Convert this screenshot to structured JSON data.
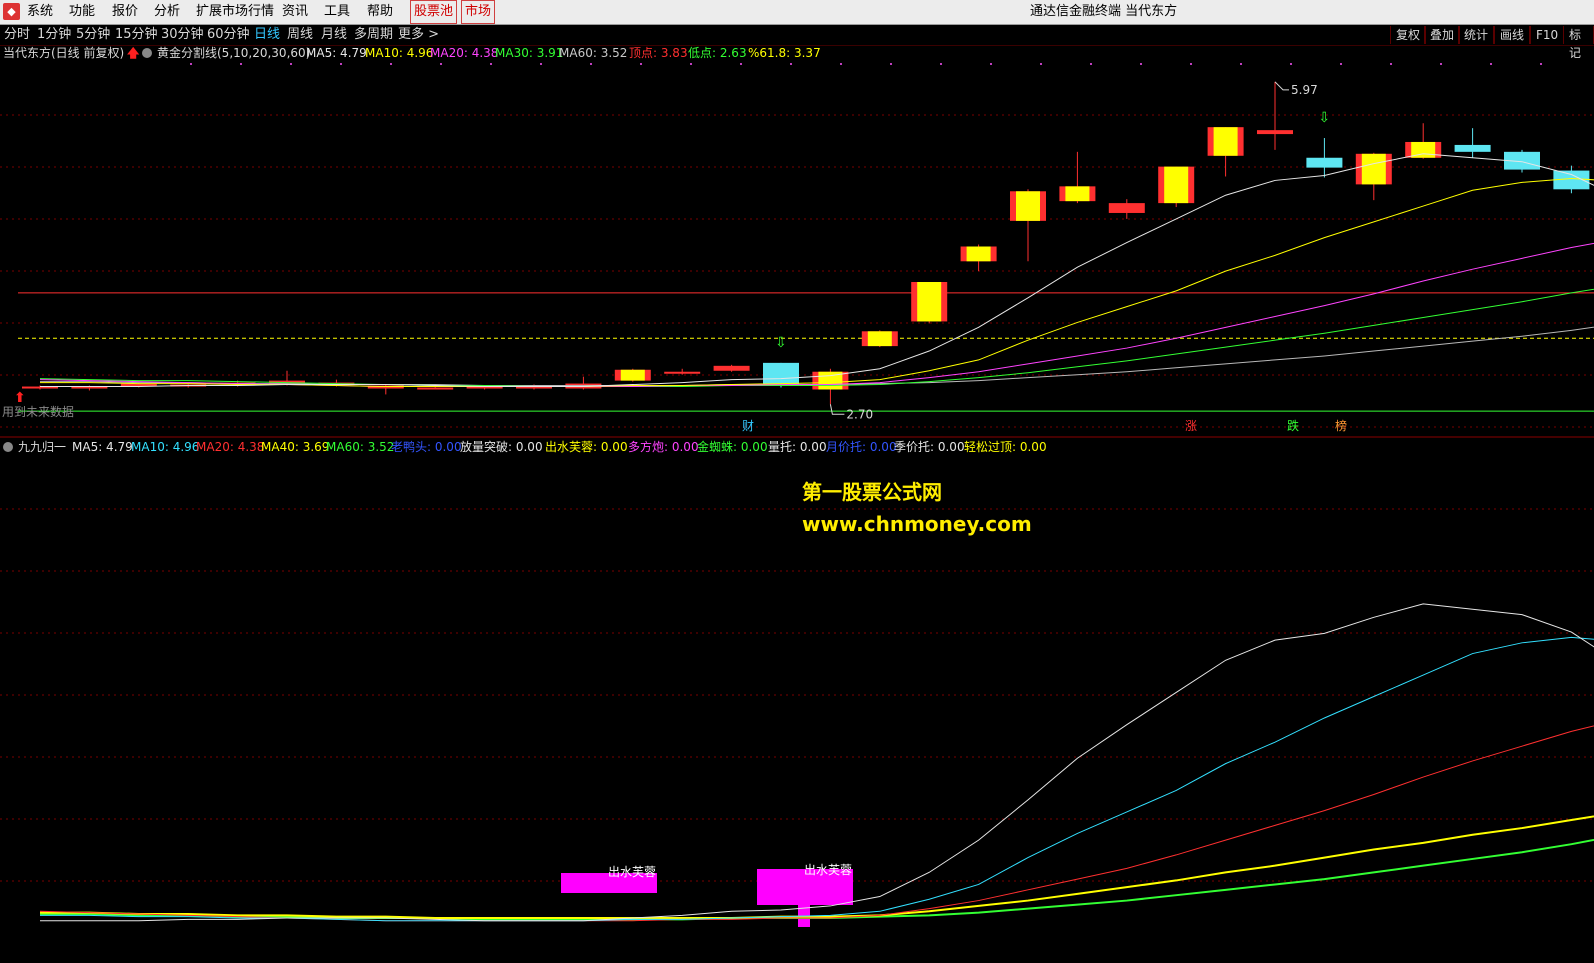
{
  "menubar": {
    "items": [
      "系统",
      "功能",
      "报价",
      "分析",
      "扩展市场行情",
      "资讯",
      "工具",
      "帮助"
    ],
    "stock_pool": "股票池",
    "market": "市场",
    "title": "通达信金融终端  当代东方"
  },
  "period_tabs": [
    "分时",
    "1分钟",
    "5分钟",
    "15分钟",
    "30分钟",
    "60分钟",
    "日线",
    "周线",
    "月线",
    "多周期",
    "更多 >"
  ],
  "active_period": "日线",
  "toolbar": [
    "复权",
    "叠加",
    "统计",
    "画线",
    "F10",
    "标记"
  ],
  "main_legend": {
    "stock": "当代东方(日线 前复权)",
    "indicator": "黄金分割线(5,10,20,30,60)",
    "items": [
      {
        "label": "MA5: 4.79",
        "color": "#e6e6e6"
      },
      {
        "label": "MA10: 4.96",
        "color": "#ffff00"
      },
      {
        "label": "MA20: 4.38",
        "color": "#ff44ff"
      },
      {
        "label": "MA30: 3.91",
        "color": "#33ff33"
      },
      {
        "label": "MA60: 3.52",
        "color": "#c8c8c8"
      },
      {
        "label": "顶点: 3.83",
        "color": "#ff3030"
      },
      {
        "label": "低点: 2.63",
        "color": "#33ff33"
      },
      {
        "label": "%61.8: 3.37",
        "color": "#ffff00"
      }
    ]
  },
  "main_chart": {
    "high_label": "5.97",
    "low_label": "2.70",
    "future_note": "用到未来数据",
    "event_markers": [
      "财",
      "涨",
      "跌",
      "榜"
    ],
    "candles": [
      {
        "o": 2.87,
        "c": 2.88,
        "h": 2.89,
        "l": 2.85
      },
      {
        "o": 2.88,
        "c": 2.87,
        "h": 2.89,
        "l": 2.84
      },
      {
        "o": 2.88,
        "c": 2.91,
        "h": 2.92,
        "l": 2.87
      },
      {
        "o": 2.9,
        "c": 2.89,
        "h": 2.91,
        "l": 2.87
      },
      {
        "o": 2.92,
        "c": 2.9,
        "h": 2.94,
        "l": 2.88
      },
      {
        "o": 2.9,
        "c": 2.94,
        "h": 3.04,
        "l": 2.89
      },
      {
        "o": 2.92,
        "c": 2.9,
        "h": 2.95,
        "l": 2.88
      },
      {
        "o": 2.89,
        "c": 2.86,
        "h": 2.9,
        "l": 2.8
      },
      {
        "o": 2.86,
        "c": 2.87,
        "h": 2.88,
        "l": 2.85
      },
      {
        "o": 2.86,
        "c": 2.88,
        "h": 2.89,
        "l": 2.85
      },
      {
        "o": 2.88,
        "c": 2.86,
        "h": 2.9,
        "l": 2.85
      },
      {
        "o": 2.86,
        "c": 2.91,
        "h": 2.98,
        "l": 2.85
      },
      {
        "o": 2.94,
        "c": 3.05,
        "h": 3.06,
        "l": 2.93
      },
      {
        "o": 3.02,
        "c": 3.03,
        "h": 3.06,
        "l": 3.0
      },
      {
        "o": 3.04,
        "c": 3.09,
        "h": 3.1,
        "l": 3.03
      },
      {
        "o": 3.12,
        "c": 2.89,
        "h": 3.12,
        "l": 2.87,
        "hollow": true
      },
      {
        "o": 2.85,
        "c": 3.03,
        "h": 3.06,
        "l": 2.7
      },
      {
        "o": 3.29,
        "c": 3.44,
        "h": 3.45,
        "l": 3.28
      },
      {
        "o": 3.54,
        "c": 3.94,
        "h": 3.94,
        "l": 3.52
      },
      {
        "o": 4.15,
        "c": 4.3,
        "h": 4.32,
        "l": 4.05
      },
      {
        "o": 4.56,
        "c": 4.86,
        "h": 4.88,
        "l": 4.15
      },
      {
        "o": 4.76,
        "c": 4.91,
        "h": 5.26,
        "l": 4.74
      },
      {
        "o": 4.64,
        "c": 4.74,
        "h": 4.78,
        "l": 4.58
      },
      {
        "o": 4.74,
        "c": 5.11,
        "h": 5.11,
        "l": 4.7
      },
      {
        "o": 5.22,
        "c": 5.51,
        "h": 5.51,
        "l": 5.01
      },
      {
        "o": 5.44,
        "c": 5.48,
        "h": 5.97,
        "l": 5.28
      },
      {
        "o": 5.2,
        "c": 5.1,
        "h": 5.4,
        "l": 5.0,
        "hollow": true
      },
      {
        "o": 4.93,
        "c": 5.24,
        "h": 5.25,
        "l": 4.77
      },
      {
        "o": 5.2,
        "c": 5.36,
        "h": 5.55,
        "l": 5.19
      },
      {
        "o": 5.33,
        "c": 5.26,
        "h": 5.5,
        "l": 5.2,
        "hollow": true
      },
      {
        "o": 5.26,
        "c": 5.08,
        "h": 5.28,
        "l": 5.05,
        "hollow": true
      },
      {
        "o": 5.07,
        "c": 4.88,
        "h": 5.12,
        "l": 4.84,
        "hollow": true
      },
      {
        "o": 4.82,
        "c": 4.67,
        "h": 4.84,
        "l": 4.6,
        "hollow": true
      }
    ],
    "ma5": [
      2.88,
      2.88,
      2.88,
      2.89,
      2.89,
      2.9,
      2.9,
      2.9,
      2.89,
      2.88,
      2.88,
      2.88,
      2.9,
      2.92,
      2.95,
      2.96,
      2.99,
      3.06,
      3.24,
      3.48,
      3.78,
      4.09,
      4.34,
      4.58,
      4.82,
      4.97,
      5.02,
      5.14,
      5.24,
      5.2,
      5.16,
      5.03,
      4.79
    ],
    "ma10": [
      2.92,
      2.92,
      2.91,
      2.91,
      2.9,
      2.9,
      2.89,
      2.88,
      2.88,
      2.88,
      2.88,
      2.88,
      2.89,
      2.89,
      2.9,
      2.91,
      2.92,
      2.95,
      3.04,
      3.15,
      3.35,
      3.53,
      3.69,
      3.85,
      4.05,
      4.21,
      4.39,
      4.55,
      4.71,
      4.87,
      4.95,
      4.99,
      4.96
    ],
    "ma20": [
      2.95,
      2.94,
      2.93,
      2.92,
      2.91,
      2.9,
      2.89,
      2.88,
      2.88,
      2.88,
      2.88,
      2.88,
      2.88,
      2.89,
      2.89,
      2.9,
      2.9,
      2.92,
      2.97,
      3.03,
      3.11,
      3.19,
      3.27,
      3.37,
      3.48,
      3.59,
      3.7,
      3.82,
      3.95,
      4.07,
      4.18,
      4.29,
      4.38
    ],
    "ma30": [
      2.96,
      2.95,
      2.94,
      2.94,
      2.93,
      2.92,
      2.91,
      2.9,
      2.89,
      2.89,
      2.88,
      2.88,
      2.88,
      2.88,
      2.89,
      2.89,
      2.89,
      2.9,
      2.93,
      2.97,
      3.02,
      3.08,
      3.14,
      3.21,
      3.28,
      3.35,
      3.42,
      3.5,
      3.58,
      3.66,
      3.74,
      3.83,
      3.91
    ],
    "ma60": [
      2.93,
      2.93,
      2.92,
      2.92,
      2.91,
      2.91,
      2.9,
      2.9,
      2.9,
      2.89,
      2.89,
      2.89,
      2.89,
      2.89,
      2.9,
      2.9,
      2.9,
      2.91,
      2.92,
      2.94,
      2.97,
      3.0,
      3.03,
      3.07,
      3.11,
      3.15,
      3.19,
      3.24,
      3.29,
      3.34,
      3.39,
      3.45,
      3.52
    ],
    "levels": [
      {
        "name": "顶点",
        "value": 3.83,
        "color": "#ff3030",
        "style": "solid"
      },
      {
        "name": "%61.8",
        "value": 3.37,
        "color": "#ffff00",
        "style": "dashed"
      },
      {
        "name": "低点",
        "value": 2.63,
        "color": "#33ff33",
        "style": "solid"
      }
    ]
  },
  "sub_legend": {
    "name": "九九归一",
    "items": [
      {
        "label": "MA5: 4.79",
        "color": "#e6e6e6"
      },
      {
        "label": "MA10: 4.96",
        "color": "#33e0ff"
      },
      {
        "label": "MA20: 4.38",
        "color": "#ff3030"
      },
      {
        "label": "MA40: 3.69",
        "color": "#ffff00"
      },
      {
        "label": "MA60: 3.52",
        "color": "#33ff33"
      },
      {
        "label": "老鸭头: 0.00",
        "color": "#3355ff"
      },
      {
        "label": "放量突破: 0.00",
        "color": "#e6e6e6"
      },
      {
        "label": "出水芙蓉: 0.00",
        "color": "#ffff00"
      },
      {
        "label": "多方炮: 0.00",
        "color": "#ff44ff"
      },
      {
        "label": "金蜘蛛: 0.00",
        "color": "#33ff33"
      },
      {
        "label": "量托: 0.00",
        "color": "#e6e6e6"
      },
      {
        "label": "月价托: 0.00",
        "color": "#3355ff"
      },
      {
        "label": "季价托: 0.00",
        "color": "#e6e6e6"
      },
      {
        "label": "轻松过顶: 0.00",
        "color": "#ffff00"
      }
    ]
  },
  "sub_chart": {
    "signal_label": "出水芙蓉",
    "ma5": [
      2.88,
      2.88,
      2.88,
      2.89,
      2.89,
      2.9,
      2.9,
      2.9,
      2.89,
      2.88,
      2.88,
      2.88,
      2.9,
      2.92,
      2.95,
      2.96,
      2.99,
      3.06,
      3.24,
      3.48,
      3.78,
      4.09,
      4.34,
      4.58,
      4.82,
      4.97,
      5.02,
      5.14,
      5.24,
      5.2,
      5.16,
      5.03,
      4.79
    ],
    "ma10": [
      2.92,
      2.92,
      2.91,
      2.91,
      2.9,
      2.9,
      2.89,
      2.88,
      2.88,
      2.88,
      2.88,
      2.88,
      2.89,
      2.89,
      2.9,
      2.91,
      2.92,
      2.95,
      3.04,
      3.15,
      3.35,
      3.53,
      3.69,
      3.85,
      4.05,
      4.21,
      4.39,
      4.55,
      4.71,
      4.87,
      4.95,
      4.99,
      4.96
    ],
    "ma20": [
      2.95,
      2.94,
      2.93,
      2.92,
      2.91,
      2.9,
      2.89,
      2.88,
      2.88,
      2.88,
      2.88,
      2.88,
      2.88,
      2.89,
      2.89,
      2.9,
      2.9,
      2.92,
      2.97,
      3.03,
      3.11,
      3.19,
      3.27,
      3.37,
      3.48,
      3.59,
      3.7,
      3.82,
      3.95,
      4.07,
      4.18,
      4.29,
      4.38
    ],
    "ma40": [
      2.94,
      2.94,
      2.93,
      2.93,
      2.92,
      2.92,
      2.91,
      2.91,
      2.9,
      2.9,
      2.9,
      2.9,
      2.9,
      2.9,
      2.9,
      2.91,
      2.91,
      2.92,
      2.95,
      2.99,
      3.03,
      3.08,
      3.13,
      3.18,
      3.24,
      3.29,
      3.35,
      3.41,
      3.46,
      3.52,
      3.57,
      3.63,
      3.69
    ],
    "ma60": [
      2.93,
      2.93,
      2.92,
      2.92,
      2.91,
      2.91,
      2.9,
      2.9,
      2.9,
      2.89,
      2.89,
      2.89,
      2.89,
      2.89,
      2.9,
      2.9,
      2.9,
      2.91,
      2.92,
      2.94,
      2.97,
      3.0,
      3.03,
      3.07,
      3.11,
      3.15,
      3.19,
      3.24,
      3.29,
      3.34,
      3.39,
      3.45,
      3.52
    ]
  },
  "watermark": {
    "line1": "第一股票公式网",
    "line2": "www.chnmoney.com"
  },
  "colors": {
    "up": "#ff3030",
    "down": "#5ee6f2",
    "body_fill": "#ffff00",
    "grid": "#7a0000",
    "signal": "#ff00ff"
  }
}
